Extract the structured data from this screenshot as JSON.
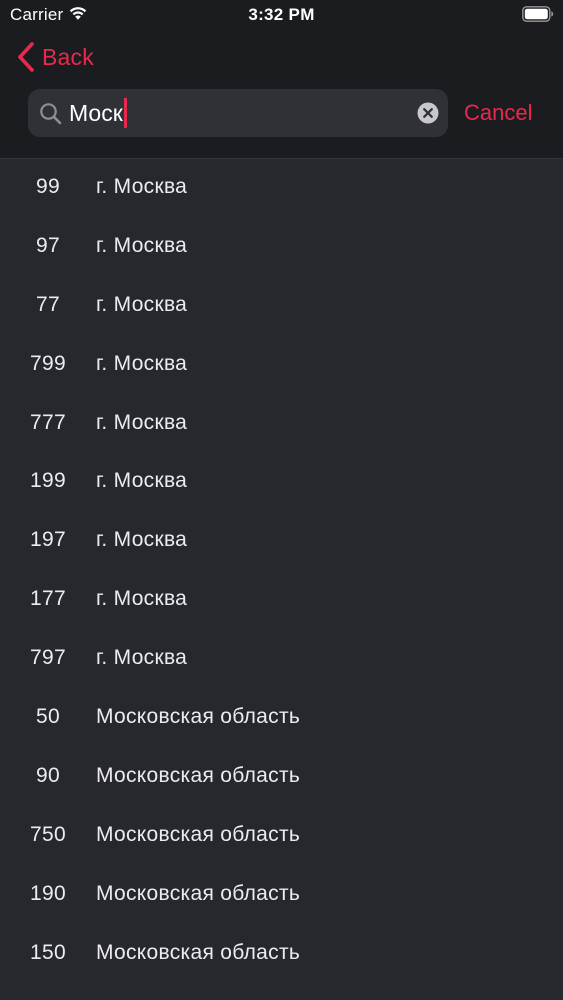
{
  "status_bar": {
    "carrier": "Carrier",
    "time": "3:32 PM",
    "icons": [
      "wifi-icon",
      "battery-icon"
    ]
  },
  "nav": {
    "back_label": "Back",
    "icon": "chevron-left-icon"
  },
  "search": {
    "value": "Моск",
    "placeholder": "",
    "cancel_label": "Cancel",
    "icons": [
      "search-icon",
      "clear-icon"
    ]
  },
  "colors": {
    "accent": "#e8294d",
    "header_background": "#1b1c20",
    "list_background": "#26282d",
    "search_field": "#2f3136",
    "text": "#ececee"
  },
  "results": [
    {
      "code": "99",
      "name": "г. Москва"
    },
    {
      "code": "97",
      "name": "г. Москва"
    },
    {
      "code": "77",
      "name": "г. Москва"
    },
    {
      "code": "799",
      "name": "г. Москва"
    },
    {
      "code": "777",
      "name": "г. Москва"
    },
    {
      "code": "199",
      "name": "г. Москва"
    },
    {
      "code": "197",
      "name": "г. Москва"
    },
    {
      "code": "177",
      "name": "г. Москва"
    },
    {
      "code": "797",
      "name": "г. Москва"
    },
    {
      "code": "50",
      "name": "Московская область"
    },
    {
      "code": "90",
      "name": "Московская область"
    },
    {
      "code": "750",
      "name": "Московская область"
    },
    {
      "code": "190",
      "name": "Московская область"
    },
    {
      "code": "150",
      "name": "Московская область"
    }
  ]
}
